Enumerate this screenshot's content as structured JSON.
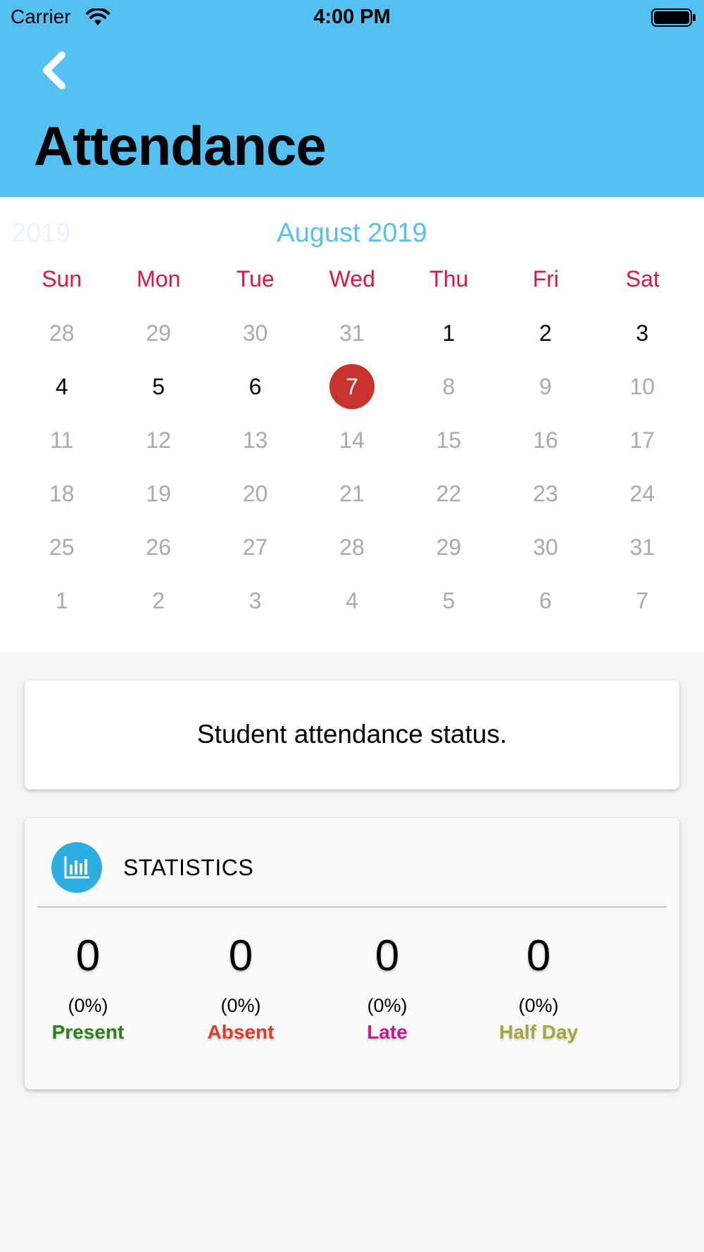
{
  "status_bar": {
    "carrier": "Carrier",
    "time": "4:00 PM"
  },
  "header": {
    "title": "Attendance",
    "back_icon": "chevron-left-icon"
  },
  "calendar": {
    "prev_year": "2019",
    "month_title": "August 2019",
    "weekdays": [
      "Sun",
      "Mon",
      "Tue",
      "Wed",
      "Thu",
      "Fri",
      "Sat"
    ],
    "weeks": [
      [
        {
          "d": "28",
          "s": "muted"
        },
        {
          "d": "29",
          "s": "muted"
        },
        {
          "d": "30",
          "s": "muted"
        },
        {
          "d": "31",
          "s": "muted"
        },
        {
          "d": "1",
          "s": "active"
        },
        {
          "d": "2",
          "s": "active"
        },
        {
          "d": "3",
          "s": "active"
        }
      ],
      [
        {
          "d": "4",
          "s": "active"
        },
        {
          "d": "5",
          "s": "active"
        },
        {
          "d": "6",
          "s": "active"
        },
        {
          "d": "7",
          "s": "selected"
        },
        {
          "d": "8",
          "s": "muted"
        },
        {
          "d": "9",
          "s": "muted"
        },
        {
          "d": "10",
          "s": "muted"
        }
      ],
      [
        {
          "d": "11",
          "s": "muted"
        },
        {
          "d": "12",
          "s": "muted"
        },
        {
          "d": "13",
          "s": "muted"
        },
        {
          "d": "14",
          "s": "muted"
        },
        {
          "d": "15",
          "s": "muted"
        },
        {
          "d": "16",
          "s": "muted"
        },
        {
          "d": "17",
          "s": "muted"
        }
      ],
      [
        {
          "d": "18",
          "s": "muted"
        },
        {
          "d": "19",
          "s": "muted"
        },
        {
          "d": "20",
          "s": "muted"
        },
        {
          "d": "21",
          "s": "muted"
        },
        {
          "d": "22",
          "s": "muted"
        },
        {
          "d": "23",
          "s": "muted"
        },
        {
          "d": "24",
          "s": "muted"
        }
      ],
      [
        {
          "d": "25",
          "s": "muted"
        },
        {
          "d": "26",
          "s": "muted"
        },
        {
          "d": "27",
          "s": "muted"
        },
        {
          "d": "28",
          "s": "muted"
        },
        {
          "d": "29",
          "s": "muted"
        },
        {
          "d": "30",
          "s": "muted"
        },
        {
          "d": "31",
          "s": "muted"
        }
      ],
      [
        {
          "d": "1",
          "s": "muted"
        },
        {
          "d": "2",
          "s": "muted"
        },
        {
          "d": "3",
          "s": "muted"
        },
        {
          "d": "4",
          "s": "muted"
        },
        {
          "d": "5",
          "s": "muted"
        },
        {
          "d": "6",
          "s": "muted"
        },
        {
          "d": "7",
          "s": "muted"
        }
      ]
    ],
    "selected_color": "#c7322b",
    "weekday_color": "#e0163e"
  },
  "status_card": {
    "text": "Student attendance status."
  },
  "statistics": {
    "title": "STATISTICS",
    "icon": "bar-chart-icon",
    "items": [
      {
        "count": "0",
        "percent": "(0%)",
        "label": "Present",
        "color": "#2f7d1e"
      },
      {
        "count": "0",
        "percent": "(0%)",
        "label": "Absent",
        "color": "#e03a2b"
      },
      {
        "count": "0",
        "percent": "(0%)",
        "label": "Late",
        "color": "#c71a8b"
      },
      {
        "count": "0",
        "percent": "(0%)",
        "label": "Half Day",
        "color": "#a5a83a"
      }
    ]
  },
  "theme": {
    "header_bg": "#55c1f3",
    "accent": "#55c1f3"
  }
}
